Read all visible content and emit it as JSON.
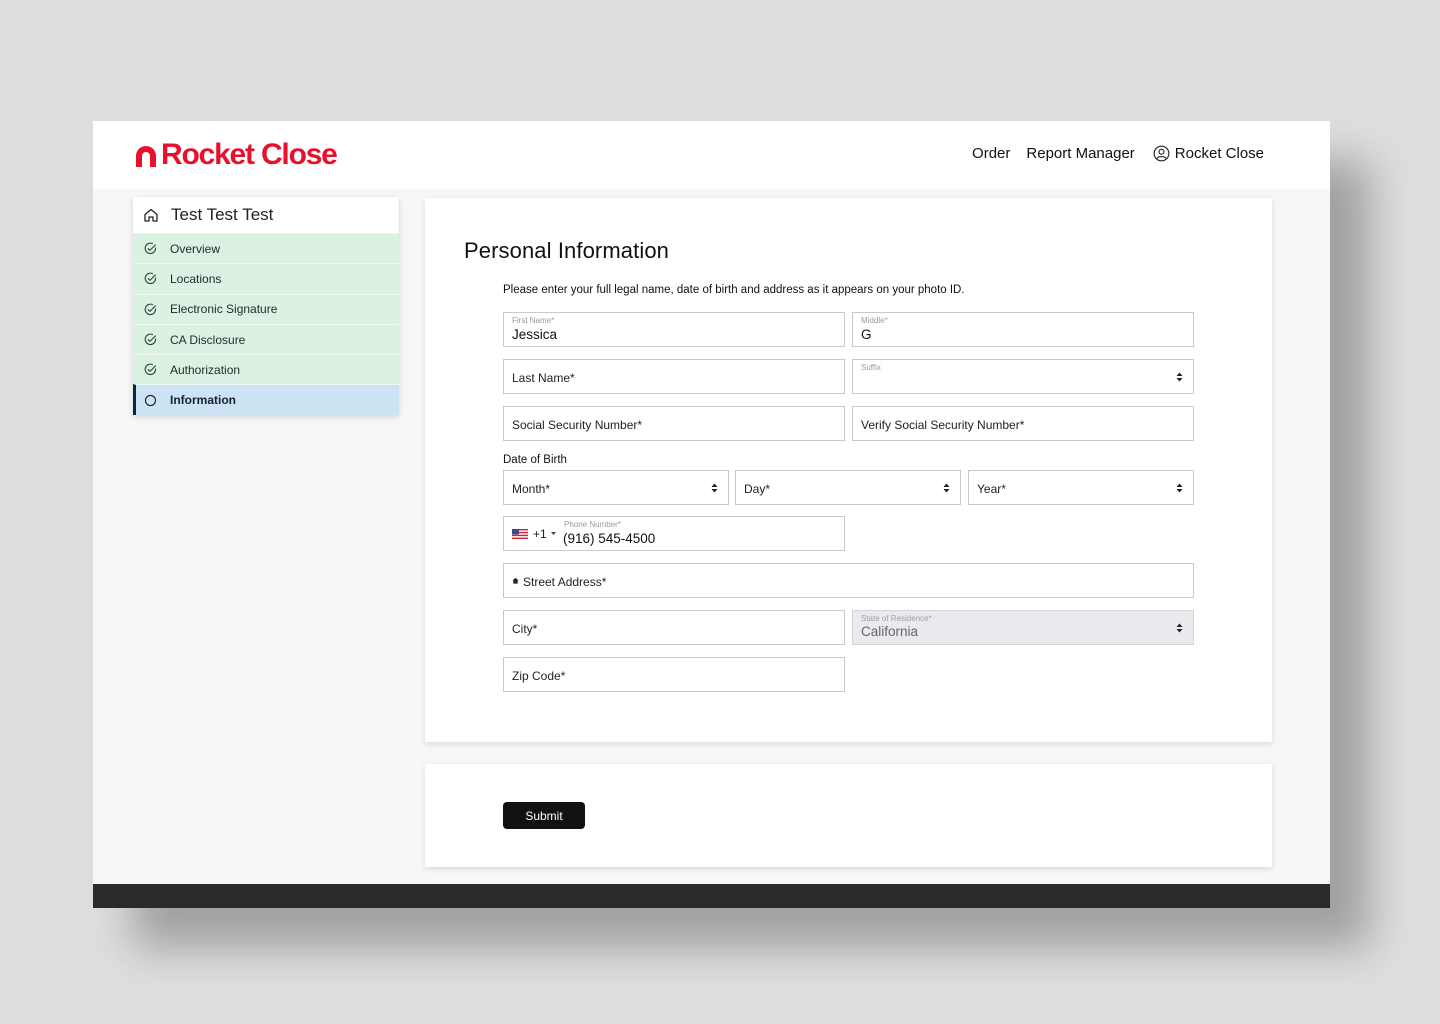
{
  "brand": {
    "name": "Rocket Close",
    "color": "#e8112d"
  },
  "nav": {
    "order": "Order",
    "report_manager": "Report Manager",
    "user_label": "Rocket Close"
  },
  "sidebar": {
    "title": "Test Test Test",
    "items": [
      {
        "label": "Overview",
        "status": "complete"
      },
      {
        "label": "Locations",
        "status": "complete"
      },
      {
        "label": "Electronic Signature",
        "status": "complete"
      },
      {
        "label": "CA Disclosure",
        "status": "complete"
      },
      {
        "label": "Authorization",
        "status": "complete"
      },
      {
        "label": "Information",
        "status": "active"
      }
    ]
  },
  "form": {
    "title": "Personal Information",
    "instructions": "Please enter your full legal name, date of birth and address as it appears on your photo ID.",
    "first_name": {
      "label": "First Name*",
      "value": "Jessica"
    },
    "middle": {
      "label": "Middle*",
      "value": "G"
    },
    "last_name": {
      "placeholder": "Last Name*"
    },
    "suffix": {
      "label": "Suffix",
      "value": ""
    },
    "ssn": {
      "placeholder": "Social Security Number*"
    },
    "verify_ssn": {
      "placeholder": "Verify Social Security Number*"
    },
    "dob": {
      "label": "Date of Birth",
      "month": "Month*",
      "day": "Day*",
      "year": "Year*"
    },
    "phone": {
      "country_code": "+1",
      "label": "Phone Number*",
      "value": "(916) 545-4500",
      "flag": "us-flag-icon"
    },
    "street": {
      "placeholder": "Street Address*"
    },
    "city": {
      "placeholder": "City*"
    },
    "state": {
      "label": "State of Residence*",
      "value": "California",
      "disabled": true
    },
    "zip": {
      "placeholder": "Zip Code*"
    }
  },
  "actions": {
    "submit_label": "Submit"
  }
}
